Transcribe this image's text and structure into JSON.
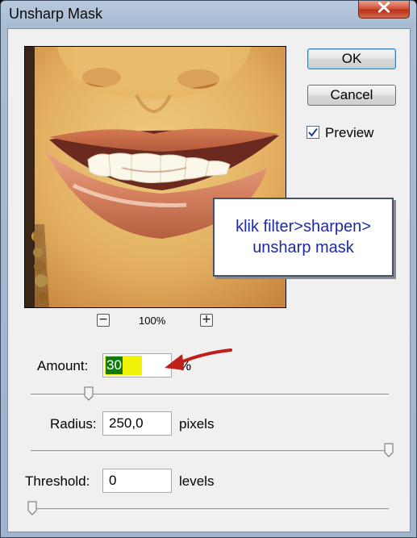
{
  "dialog": {
    "title": "Unsharp Mask"
  },
  "buttons": {
    "ok": "OK",
    "cancel": "Cancel"
  },
  "preview": {
    "label": "Preview",
    "checked": true
  },
  "zoom": {
    "minus": "−",
    "plus": "+",
    "level": "100%"
  },
  "callout": {
    "text": "klik filter>sharpen>\nunsharp mask"
  },
  "fields": {
    "amount": {
      "label": "Amount:",
      "value": "30",
      "unit": "%",
      "slider_fraction": 0.145
    },
    "radius": {
      "label": "Radius:",
      "value": "250,0",
      "unit": "pixels",
      "slider_fraction": 1.0
    },
    "threshold": {
      "label": "Threshold:",
      "value": "0",
      "unit": "levels",
      "slider_fraction": 0.0
    }
  },
  "colors": {
    "callout_text": "#1f2aa6",
    "highlight": "#f0f20a",
    "arrow": "#c0201c"
  },
  "icons": {
    "close": "close-icon",
    "arrow": "annotation-arrow",
    "check": "checkmark-icon"
  }
}
